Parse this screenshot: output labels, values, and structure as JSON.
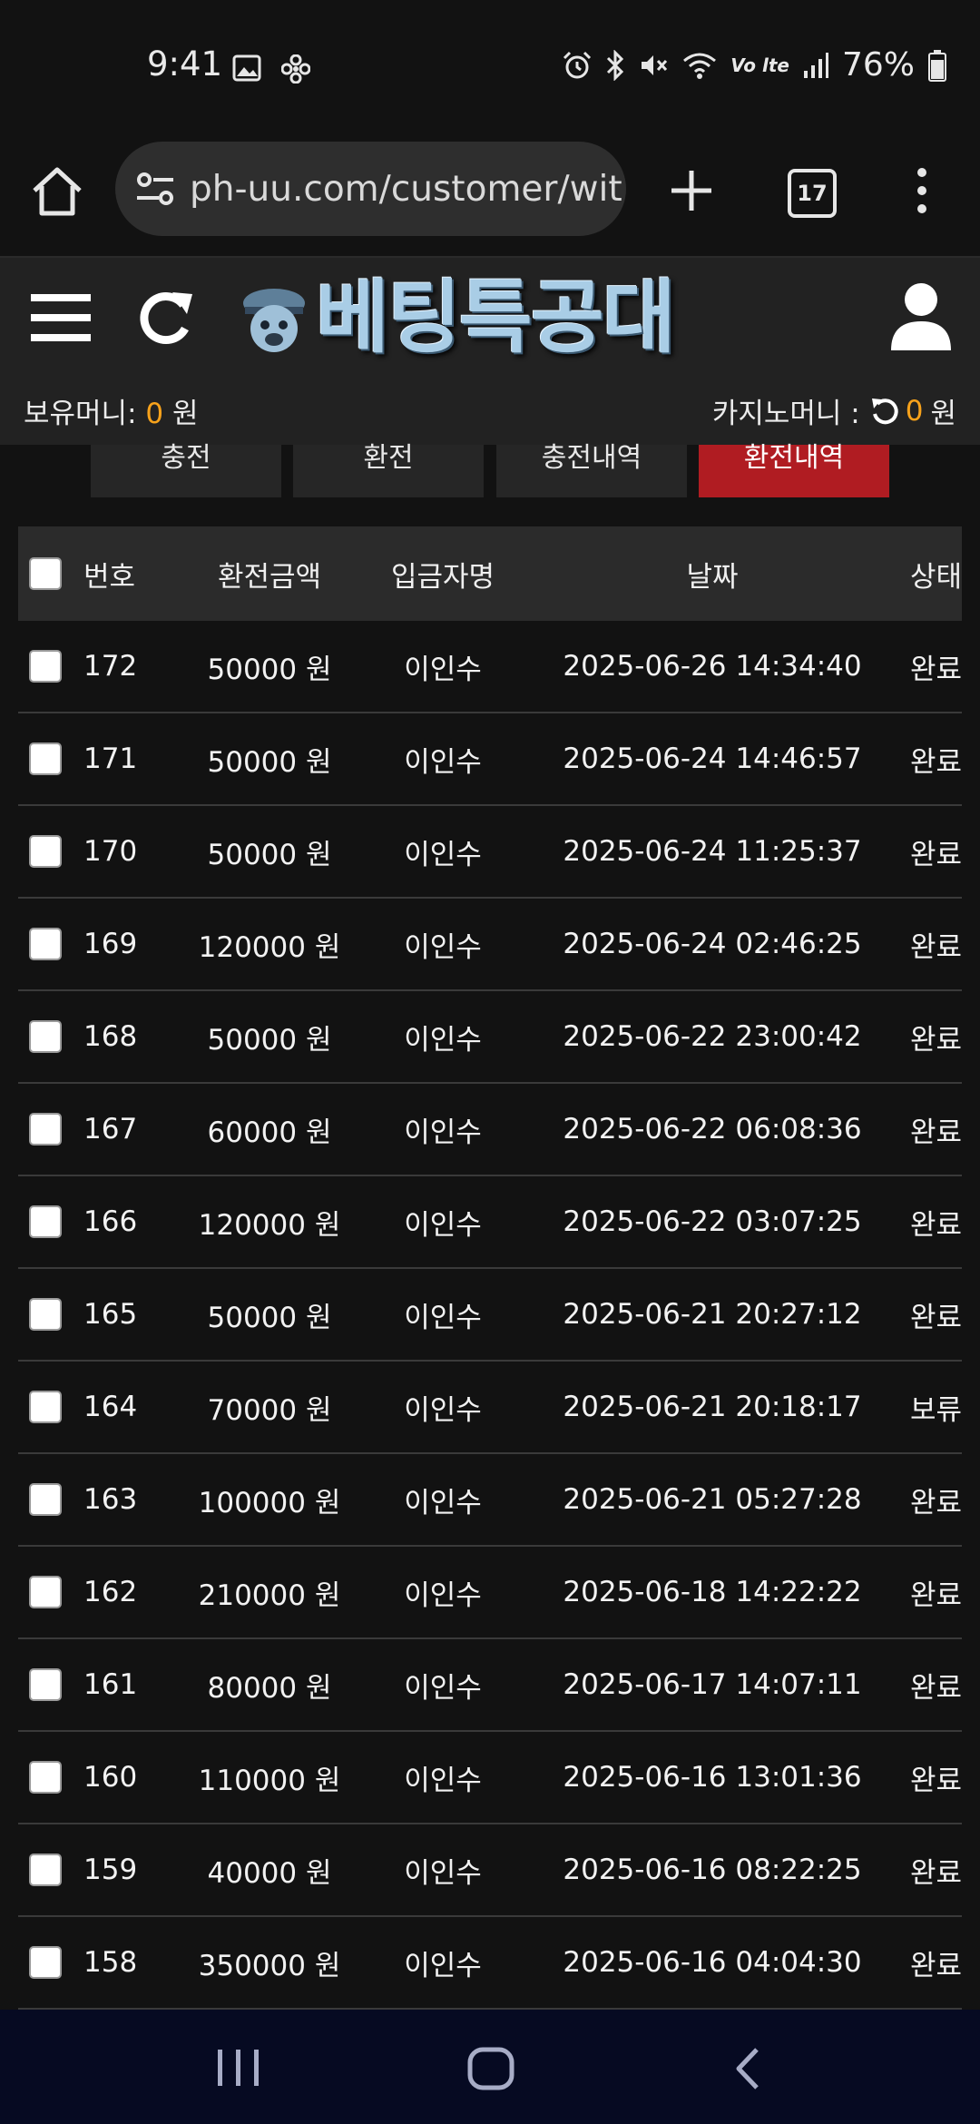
{
  "status_bar": {
    "time": "9:41",
    "left_icons": [
      "image-icon",
      "pinwheel-icon"
    ],
    "right_icons": [
      "alarm-icon",
      "bluetooth-icon",
      "mute-icon",
      "wifi-icon",
      "volte-icon",
      "signal-icon",
      "battery-icon"
    ],
    "lte_label": "Vo lte",
    "battery": "76%"
  },
  "browser": {
    "url": "ph-uu.com/customer/wit",
    "tab_count": "17"
  },
  "header": {
    "logo_text": "베팅특공대",
    "holding_money_label": "보유머니:",
    "holding_money_value": "0",
    "holding_money_unit": "원",
    "casino_money_label": "카지노머니 :",
    "casino_money_value": "0",
    "casino_money_unit": "원",
    "accent_color": "#f7a21b"
  },
  "tabs": [
    {
      "label": "충전",
      "active": false
    },
    {
      "label": "환전",
      "active": false
    },
    {
      "label": "충전내역",
      "active": false
    },
    {
      "label": "환전내역",
      "active": true
    }
  ],
  "table": {
    "columns": [
      "번호",
      "환전금액",
      "입금자명",
      "날짜",
      "상태"
    ],
    "rows": [
      {
        "no": "172",
        "amount": "50000 원",
        "name": "이인수",
        "date": "2025-06-26 14:34:40",
        "status": "완료"
      },
      {
        "no": "171",
        "amount": "50000 원",
        "name": "이인수",
        "date": "2025-06-24 14:46:57",
        "status": "완료"
      },
      {
        "no": "170",
        "amount": "50000 원",
        "name": "이인수",
        "date": "2025-06-24 11:25:37",
        "status": "완료"
      },
      {
        "no": "169",
        "amount": "120000 원",
        "name": "이인수",
        "date": "2025-06-24 02:46:25",
        "status": "완료"
      },
      {
        "no": "168",
        "amount": "50000 원",
        "name": "이인수",
        "date": "2025-06-22 23:00:42",
        "status": "완료"
      },
      {
        "no": "167",
        "amount": "60000 원",
        "name": "이인수",
        "date": "2025-06-22 06:08:36",
        "status": "완료"
      },
      {
        "no": "166",
        "amount": "120000 원",
        "name": "이인수",
        "date": "2025-06-22 03:07:25",
        "status": "완료"
      },
      {
        "no": "165",
        "amount": "50000 원",
        "name": "이인수",
        "date": "2025-06-21 20:27:12",
        "status": "완료"
      },
      {
        "no": "164",
        "amount": "70000 원",
        "name": "이인수",
        "date": "2025-06-21 20:18:17",
        "status": "보류"
      },
      {
        "no": "163",
        "amount": "100000 원",
        "name": "이인수",
        "date": "2025-06-21 05:27:28",
        "status": "완료"
      },
      {
        "no": "162",
        "amount": "210000 원",
        "name": "이인수",
        "date": "2025-06-18 14:22:22",
        "status": "완료"
      },
      {
        "no": "161",
        "amount": "80000 원",
        "name": "이인수",
        "date": "2025-06-17 14:07:11",
        "status": "완료"
      },
      {
        "no": "160",
        "amount": "110000 원",
        "name": "이인수",
        "date": "2025-06-16 13:01:36",
        "status": "완료"
      },
      {
        "no": "159",
        "amount": "40000 원",
        "name": "이인수",
        "date": "2025-06-16 08:22:25",
        "status": "완료"
      },
      {
        "no": "158",
        "amount": "350000 원",
        "name": "이인수",
        "date": "2025-06-16 04:04:30",
        "status": "완료"
      }
    ]
  },
  "nav_bar": {
    "icons": [
      "recents-icon",
      "home-icon",
      "back-icon"
    ]
  }
}
